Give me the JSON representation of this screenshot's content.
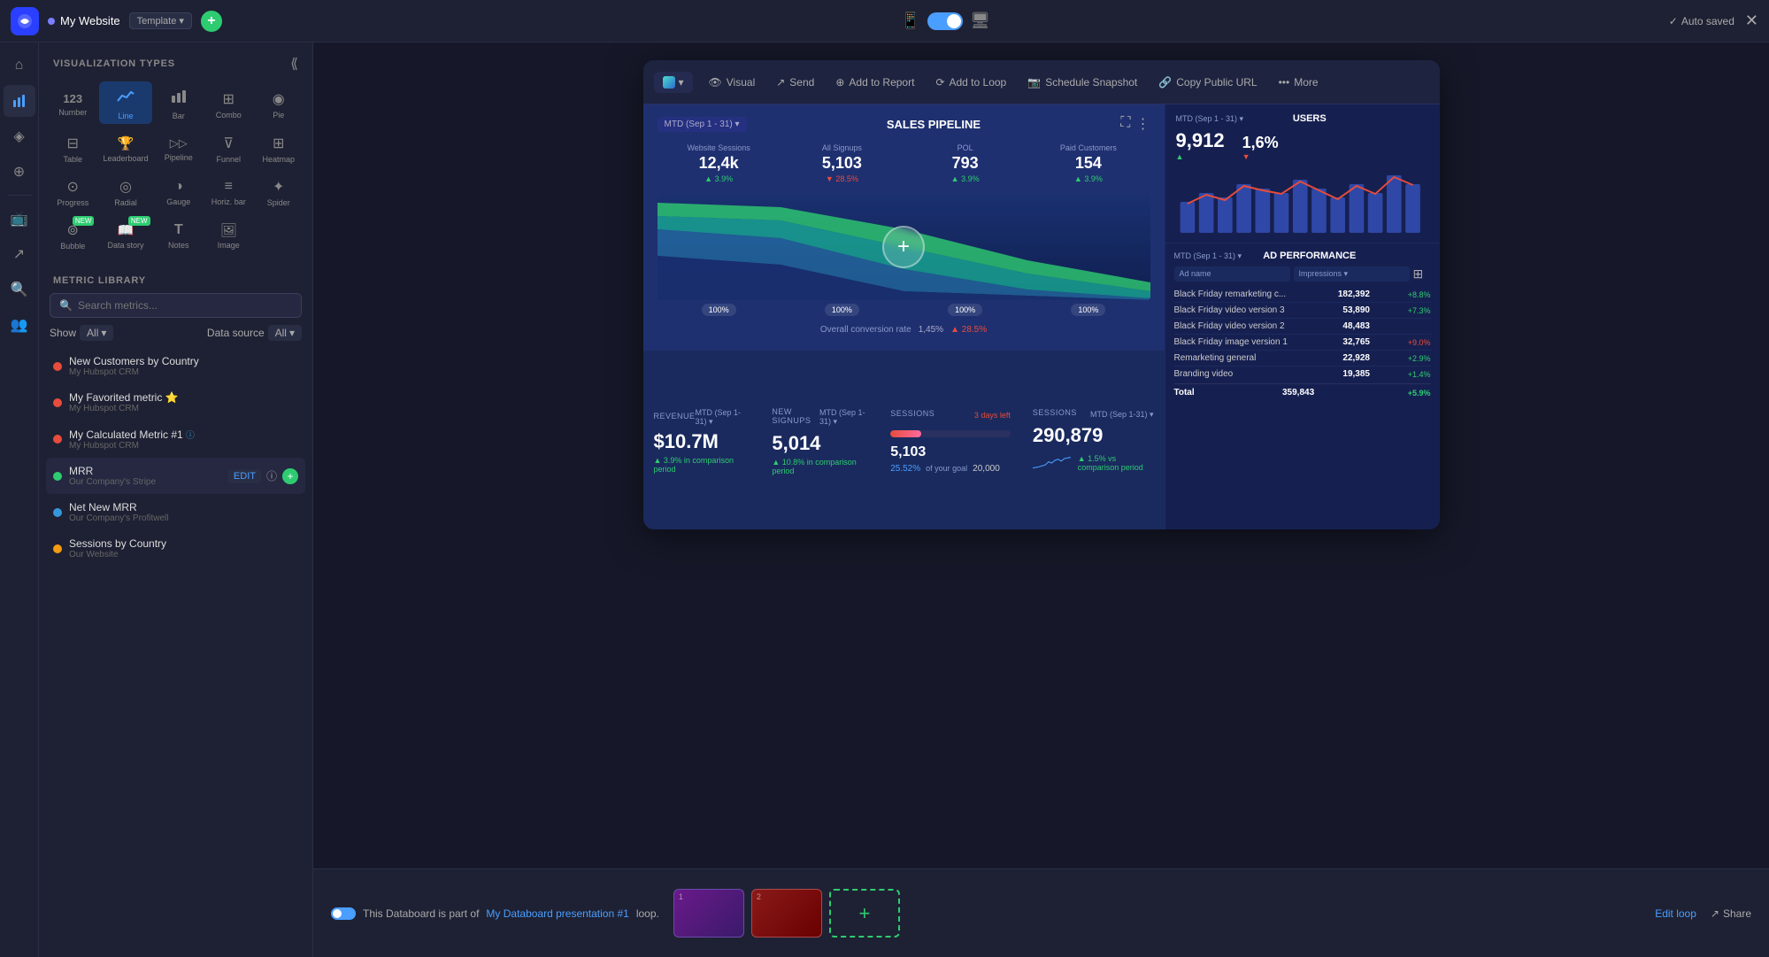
{
  "app": {
    "title": "My Website",
    "template_label": "Template",
    "auto_saved": "Auto saved"
  },
  "top_nav": {
    "add_btn": "+",
    "close_btn": "✕"
  },
  "panel": {
    "viz_title": "VISUALIZATION TYPES",
    "metric_title": "METRIC LIBRARY",
    "search_placeholder": "Search metrics...",
    "show_label": "Show",
    "show_value": "All",
    "data_source_label": "Data source",
    "data_source_value": "All"
  },
  "viz_types": [
    {
      "id": "number",
      "label": "Number",
      "icon": "123"
    },
    {
      "id": "line",
      "label": "Line",
      "icon": "📈",
      "active": true
    },
    {
      "id": "bar",
      "label": "Bar",
      "icon": "📊"
    },
    {
      "id": "combo",
      "label": "Combo",
      "icon": "⊞"
    },
    {
      "id": "pie",
      "label": "Pie",
      "icon": "◉"
    },
    {
      "id": "table",
      "label": "Table",
      "icon": "⊟"
    },
    {
      "id": "leaderboard",
      "label": "Leaderboard",
      "icon": "🏆"
    },
    {
      "id": "pipeline",
      "label": "Pipeline",
      "icon": "▷▷"
    },
    {
      "id": "funnel",
      "label": "Funnel",
      "icon": "⊽"
    },
    {
      "id": "heatmap",
      "label": "Heatmap",
      "icon": "⊞"
    },
    {
      "id": "progress",
      "label": "Progress",
      "icon": "⊙"
    },
    {
      "id": "radial",
      "label": "Radial",
      "icon": "◎"
    },
    {
      "id": "gauge",
      "label": "Gauge",
      "icon": "◑"
    },
    {
      "id": "horiz_bar",
      "label": "Horiz. bar",
      "icon": "≡"
    },
    {
      "id": "spider",
      "label": "Spider",
      "icon": "✦"
    },
    {
      "id": "bubble",
      "label": "Bubble",
      "icon": "⊚"
    },
    {
      "id": "data_story",
      "label": "Data story",
      "icon": "📖"
    },
    {
      "id": "notes",
      "label": "Notes",
      "icon": "T"
    },
    {
      "id": "image",
      "label": "Image",
      "icon": "🖼"
    }
  ],
  "metrics": [
    {
      "name": "New Customers by Country",
      "source": "My Hubspot CRM",
      "color": "#e74c3c",
      "active": false
    },
    {
      "name": "My Favorited metric ⭐",
      "source": "My Hubspot CRM",
      "color": "#e74c3c",
      "active": false
    },
    {
      "name": "My Calculated Metric #1",
      "source": "My Hubspot CRM",
      "color": "#e74c3c",
      "active": false
    },
    {
      "name": "MRR",
      "source": "Our Company's Stripe",
      "color": "#2ecc71",
      "active": true
    },
    {
      "name": "Net New MRR",
      "source": "Our Company's Profitwell",
      "color": "#3498db",
      "active": false
    },
    {
      "name": "Sessions by Country",
      "source": "Our Website",
      "color": "#f39c12",
      "active": false
    }
  ],
  "toolbar": {
    "date_range": "MTD (Sep 1 - 31) ▾",
    "visual_label": "Visual",
    "send_label": "Send",
    "add_to_report_label": "Add to Report",
    "add_to_loop_label": "Add to Loop",
    "schedule_label": "Schedule Snapshot",
    "copy_url_label": "Copy Public URL",
    "more_label": "More"
  },
  "sales_pipeline": {
    "date": "MTD (Sep 1 - 31) ▾",
    "title": "SALES PIPELINE",
    "metrics": [
      {
        "label": "Website Sessions",
        "value": "12,4k",
        "change": "▲ 3.9%",
        "up": true
      },
      {
        "label": "All Signups",
        "value": "5,103",
        "change": "▼ 28.5%",
        "up": false
      },
      {
        "label": "POL",
        "value": "793",
        "change": "▲ 3.9%",
        "up": true
      },
      {
        "label": "Paid Customers",
        "value": "154",
        "change": "▲ 3.9%",
        "up": true
      }
    ],
    "funnel_pcts": [
      "100%",
      "100%",
      "100%",
      "100%"
    ],
    "conversion_label": "Overall conversion rate",
    "conversion_rate": "1,45%",
    "conversion_change": "▲ 28.5%"
  },
  "bottom_metrics": [
    {
      "label": "REVENUE",
      "value": "$10.7M",
      "change": "▲ 3.9% in comparison period",
      "up": true
    },
    {
      "label": "NEW SIGNUPS",
      "value": "5,014",
      "change": "▲ 10.8% in comparison period",
      "up": true
    },
    {
      "label": "Sessions",
      "sub": "5,103",
      "days_left": "3 days left",
      "progress_pct": 25.52,
      "goal_pct": "25.52%",
      "goal": "of your goal",
      "goal_val": "20,000"
    },
    {
      "label": "SESSIONS",
      "value": "290,879",
      "change": "▲ 1.5% vs comparison period",
      "up": true
    }
  ],
  "users_widget": {
    "date": "MTD (Sep 1 - 31) ▾",
    "title": "USERS",
    "main_value": "9,912",
    "main_change": "▲",
    "pct_value": "1,6%",
    "pct_change": "▼"
  },
  "ad_performance": {
    "date": "MTD (Sep 1 - 31) ▾",
    "title": "AD PERFORMANCE",
    "rows": [
      {
        "name": "Black Friday remarketing c...",
        "value": "182,392",
        "change": "+8.8%",
        "up": true
      },
      {
        "name": "Black Friday video version 3",
        "value": "53,890",
        "change": "+7.3%",
        "up": true
      },
      {
        "name": "Black Friday video version 2",
        "value": "48,483",
        "change": "",
        "up": null
      },
      {
        "name": "Black Friday image version 1",
        "value": "32,765",
        "change": "+9.0%",
        "up": false
      },
      {
        "name": "Remarketing general",
        "value": "22,928",
        "change": "+2.9%",
        "up": true
      },
      {
        "name": "Branding video",
        "value": "19,385",
        "change": "+1.4%",
        "up": true
      }
    ],
    "total_label": "Total",
    "total_value": "359,843",
    "total_change": "+5.9%"
  },
  "loop_bar": {
    "text_prefix": "This Databoard is part of",
    "loop_name": "My Databoard presentation #1",
    "text_suffix": "loop.",
    "edit_loop": "Edit loop",
    "share": "Share",
    "slide1_num": "1",
    "slide2_num": "2"
  }
}
